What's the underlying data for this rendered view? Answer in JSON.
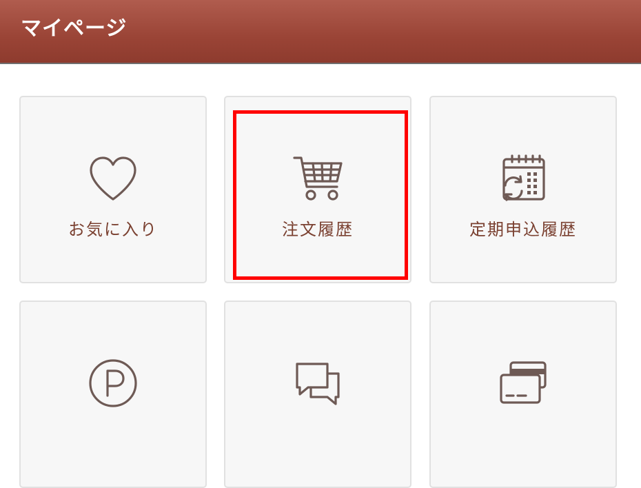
{
  "header": {
    "title": "マイページ"
  },
  "colors": {
    "header_bg": "#9a4436",
    "tile_bg": "#f7f7f7",
    "icon": "#6e5a55",
    "label": "#7a4030",
    "highlight": "#ff0000"
  },
  "tiles": [
    {
      "label": "お気に入り",
      "icon": "heart-icon"
    },
    {
      "label": "注文履歴",
      "icon": "cart-icon"
    },
    {
      "label": "定期申込履歴",
      "icon": "calendar-refresh-icon"
    },
    {
      "label": "",
      "icon": "point-icon"
    },
    {
      "label": "",
      "icon": "chat-icon"
    },
    {
      "label": "",
      "icon": "credit-card-icon"
    }
  ]
}
